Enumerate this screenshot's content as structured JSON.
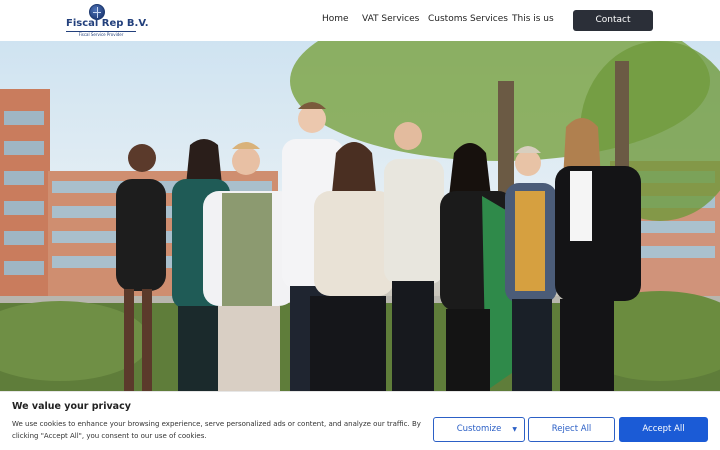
{
  "header": {
    "logo_name": "Fiscal Rep B.V.",
    "logo_tagline": "Fiscal Service Provider",
    "nav": [
      "Home",
      "VAT Services",
      "Customs Services",
      "This is us"
    ],
    "contact_label": "Contact"
  },
  "cookie": {
    "title": "We value your privacy",
    "text": "We use cookies to enhance your browsing experience, serve personalized ads or content, and analyze our traffic. By clicking \"Accept All\", you consent to our use of cookies.",
    "customize_label": "Customize",
    "reject_label": "Reject All",
    "accept_label": "Accept All"
  },
  "colors": {
    "brand": "#23407c",
    "contact_button": "#2b2f38",
    "accept_button": "#1b5bd6",
    "outline_buttons": "#2c60c6"
  },
  "icons": [
    "globe-logo-icon",
    "caret-down-icon"
  ]
}
